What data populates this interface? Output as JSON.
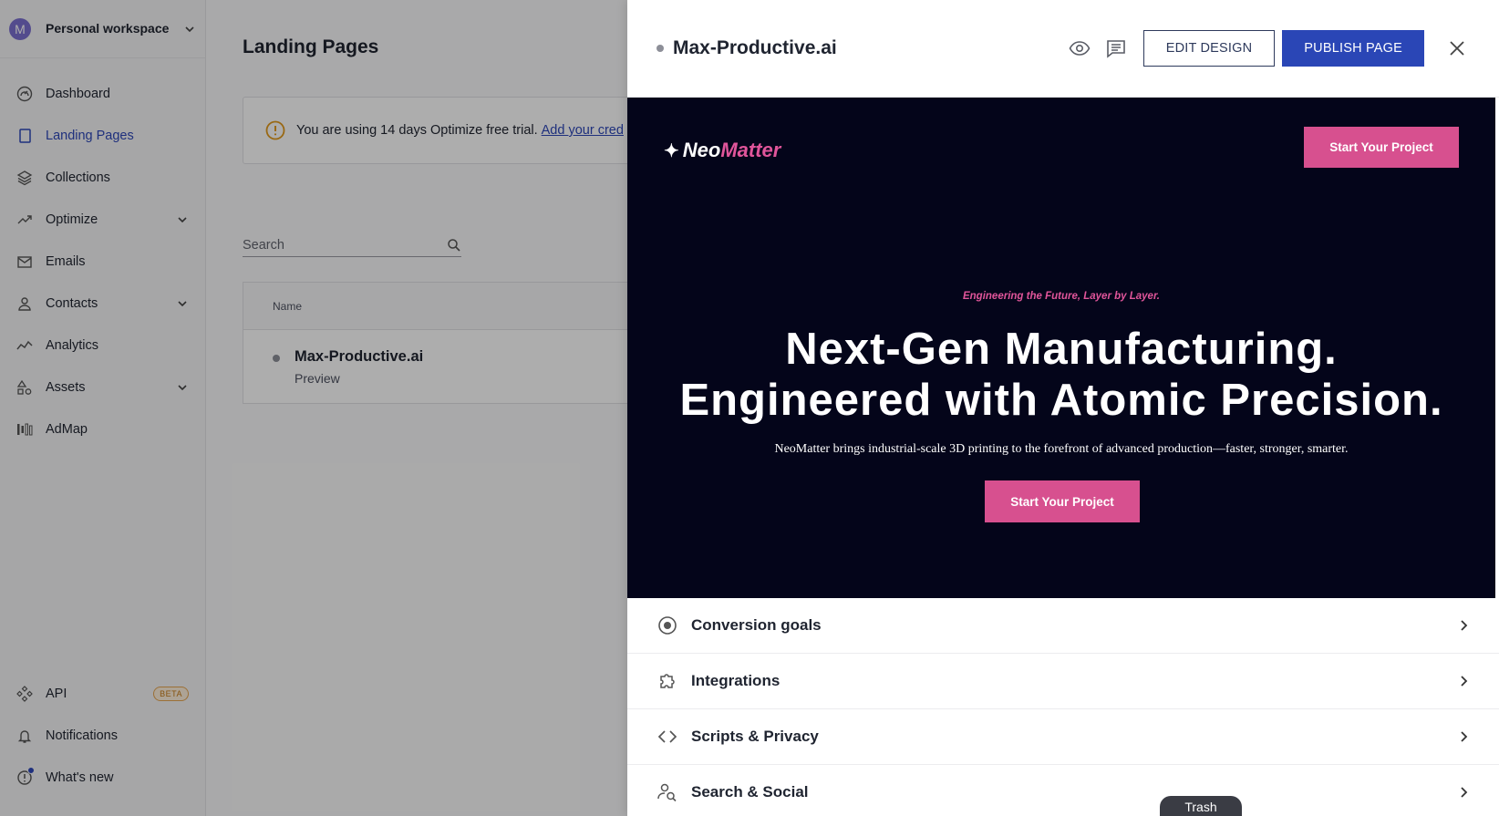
{
  "sidebar": {
    "workspace": {
      "initial": "M",
      "name": "Personal workspace"
    },
    "items": [
      {
        "label": "Dashboard",
        "icon": "dashboard-icon"
      },
      {
        "label": "Landing Pages",
        "icon": "page-icon",
        "active": true
      },
      {
        "label": "Collections",
        "icon": "layers-icon"
      },
      {
        "label": "Optimize",
        "icon": "trend-icon",
        "expandable": true
      },
      {
        "label": "Emails",
        "icon": "mail-icon"
      },
      {
        "label": "Contacts",
        "icon": "person-icon",
        "expandable": true
      },
      {
        "label": "Analytics",
        "icon": "analytics-icon"
      },
      {
        "label": "Assets",
        "icon": "shapes-icon",
        "expandable": true
      },
      {
        "label": "AdMap",
        "icon": "bars-icon"
      }
    ],
    "bottom": [
      {
        "label": "API",
        "icon": "api-icon",
        "badge": "BETA"
      },
      {
        "label": "Notifications",
        "icon": "bell-icon"
      },
      {
        "label": "What's new",
        "icon": "info-icon"
      }
    ]
  },
  "main": {
    "title": "Landing Pages",
    "trial_text": "You are using 14 days Optimize free trial.",
    "trial_link": "Add your cred",
    "search_placeholder": "Search",
    "table": {
      "header_name": "Name",
      "rows": [
        {
          "title": "Max-Productive.ai",
          "subtitle": "Preview"
        }
      ]
    }
  },
  "drawer": {
    "title": "Max-Productive.ai",
    "edit_label": "EDIT DESIGN",
    "publish_label": "PUBLISH PAGE",
    "preview": {
      "logo_part1": "Neo",
      "logo_part2": "Matter",
      "cta_top": "Start Your Project",
      "tagline": "Engineering the Future, Layer by Layer.",
      "headline_line1": "Next-Gen Manufacturing.",
      "headline_line2": "Engineered with Atomic Precision.",
      "subtext": "NeoMatter brings industrial-scale 3D printing to the forefront of advanced production—faster, stronger, smarter.",
      "cta_main": "Start Your Project"
    },
    "settings": [
      {
        "label": "Conversion goals",
        "icon": "target-icon"
      },
      {
        "label": "Integrations",
        "icon": "puzzle-icon"
      },
      {
        "label": "Scripts & Privacy",
        "icon": "code-icon"
      },
      {
        "label": "Search & Social",
        "icon": "search-person-icon"
      }
    ]
  },
  "trash_label": "Trash",
  "colors": {
    "accent": "#2a46b6",
    "pink": "#d7508f",
    "preview_bg": "#04051a"
  }
}
